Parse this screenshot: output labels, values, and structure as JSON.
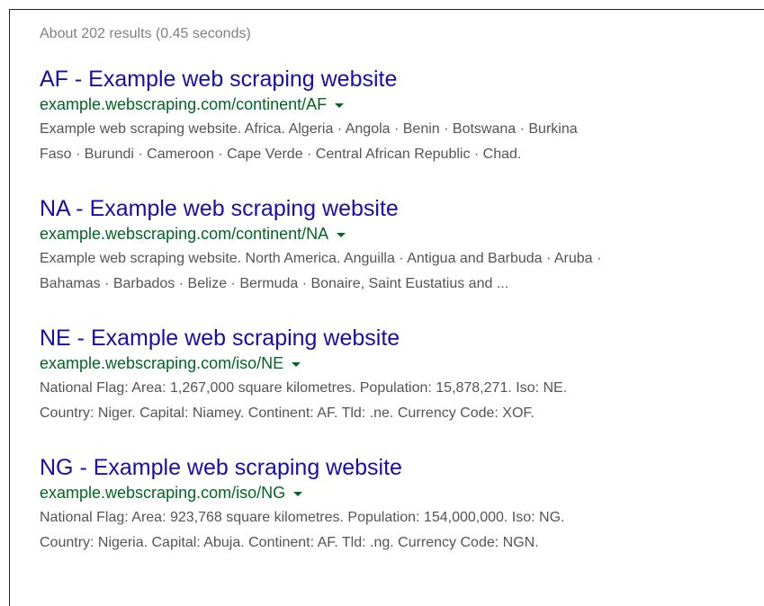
{
  "results_stats": "About 202 results (0.45 seconds)",
  "results": [
    {
      "title": "AF - Example web scraping website",
      "url": "example.webscraping.com/continent/AF",
      "snippet_lines": [
        "Example web scraping website. Africa. Algeria · Angola · Benin · Botswana · Burkina",
        "Faso · Burundi · Cameroon · Cape Verde · Central African Republic · Chad."
      ]
    },
    {
      "title": "NA - Example web scraping website",
      "url": "example.webscraping.com/continent/NA",
      "snippet_lines": [
        "Example web scraping website. North America. Anguilla · Antigua and Barbuda · Aruba ·",
        "Bahamas · Barbados · Belize · Bermuda · Bonaire, Saint Eustatius and ..."
      ]
    },
    {
      "title": "NE - Example web scraping website",
      "url": "example.webscraping.com/iso/NE",
      "snippet_lines": [
        "National Flag: Area: 1,267,000 square kilometres. Population: 15,878,271. Iso: NE.",
        "Country: Niger. Capital: Niamey. Continent: AF. Tld: .ne. Currency Code: XOF."
      ]
    },
    {
      "title": "NG - Example web scraping website",
      "url": "example.webscraping.com/iso/NG",
      "snippet_lines": [
        "National Flag: Area: 923,768 square kilometres. Population: 154,000,000. Iso: NG.",
        "Country: Nigeria. Capital: Abuja. Continent: AF. Tld: .ng. Currency Code: NGN."
      ]
    }
  ],
  "colors": {
    "title_link": "#1a0dab",
    "url": "#006621",
    "snippet": "#545454",
    "stats": "#808080"
  },
  "icons": {
    "url_dropdown": "caret-down-icon"
  }
}
